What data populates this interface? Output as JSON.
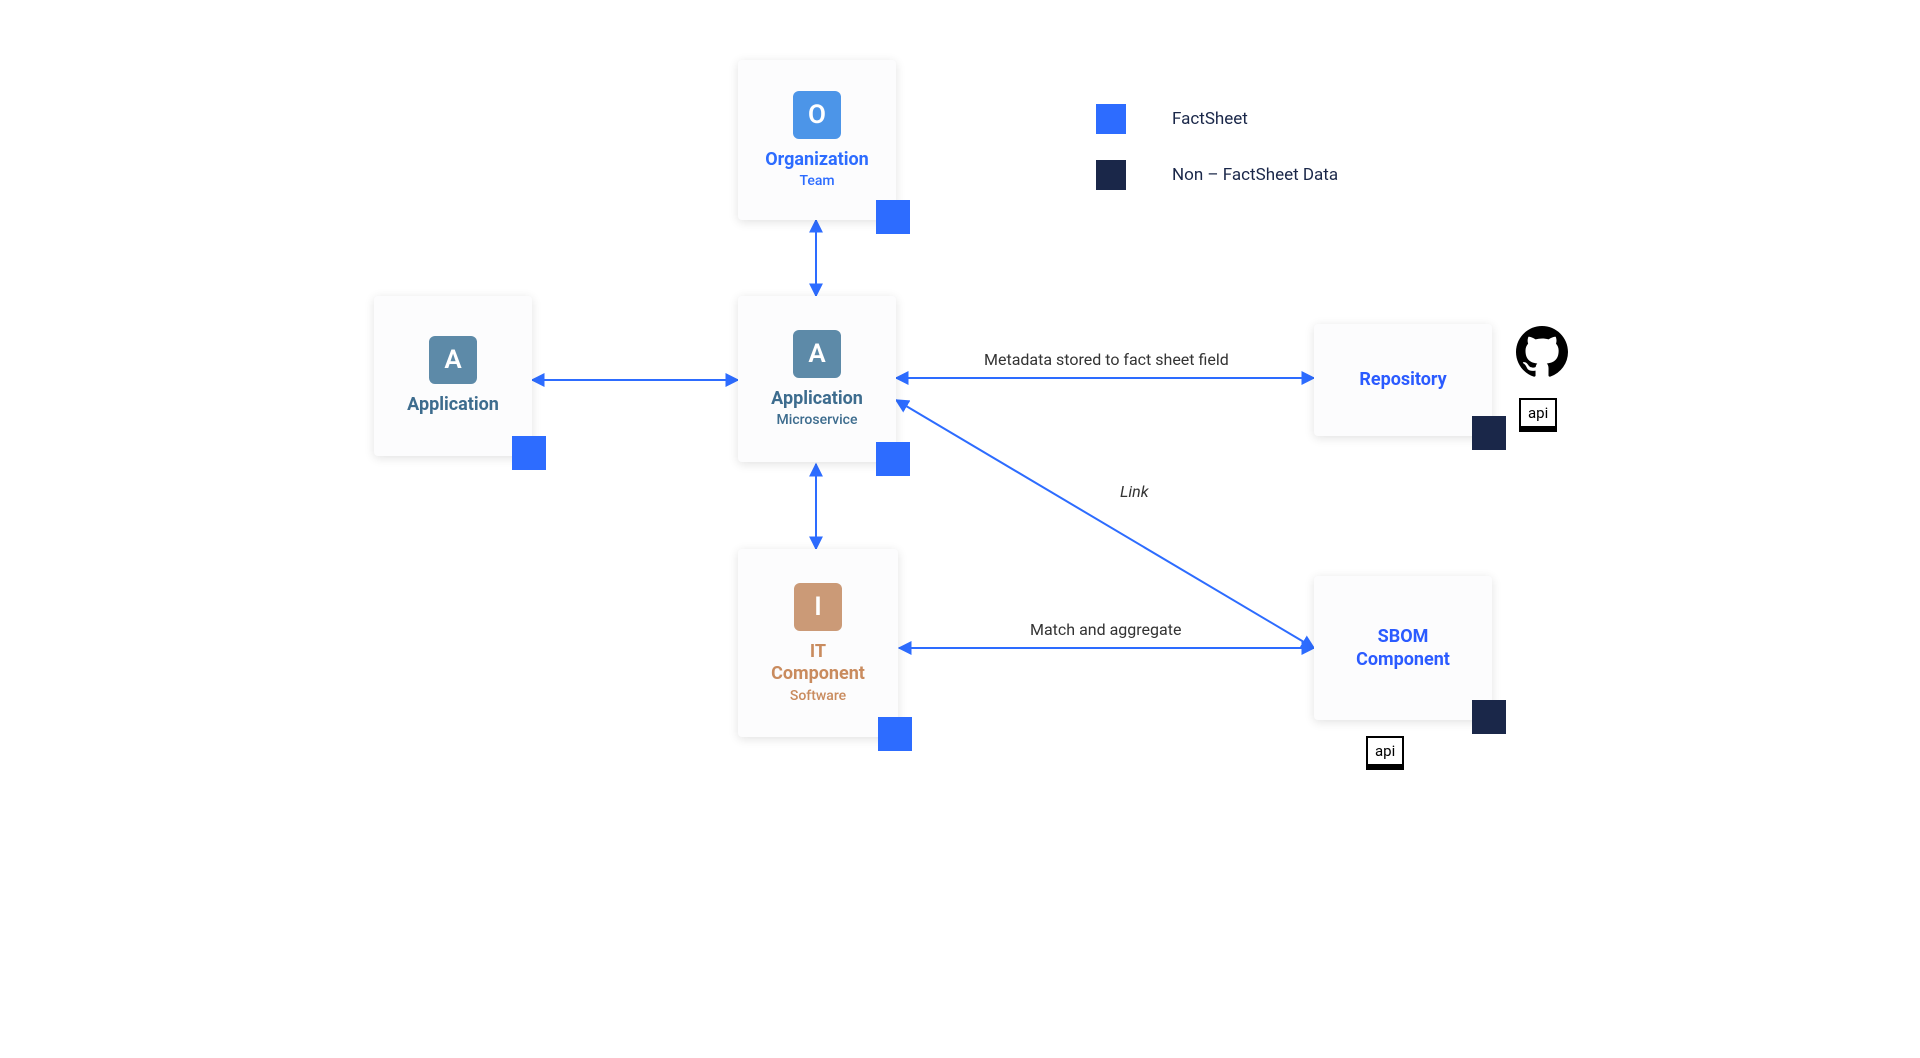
{
  "legend": {
    "factsheet": "FactSheet",
    "nonfactsheet": "Non – FactSheet Data"
  },
  "nodes": {
    "organization": {
      "letter": "O",
      "title": "Organization",
      "subtitle": "Team"
    },
    "application_left": {
      "letter": "A",
      "title": "Application"
    },
    "application_center": {
      "letter": "A",
      "title": "Application",
      "subtitle": "Microservice"
    },
    "it_component": {
      "letter": "I",
      "title": "IT Component",
      "subtitle": "Software"
    },
    "repository": {
      "title": "Repository"
    },
    "sbom_component": {
      "title": "SBOM Component"
    }
  },
  "edge_labels": {
    "metadata": "Metadata stored to fact sheet field",
    "link": "Link",
    "match": "Match and aggregate"
  },
  "icons": {
    "api": "api"
  },
  "colors": {
    "factsheet": "#2d6cff",
    "nonfactsheet": "#1a2749",
    "org_badge": "#4c95e8",
    "app_badge": "#5d8aa8",
    "itc_badge": "#cb9a77"
  }
}
